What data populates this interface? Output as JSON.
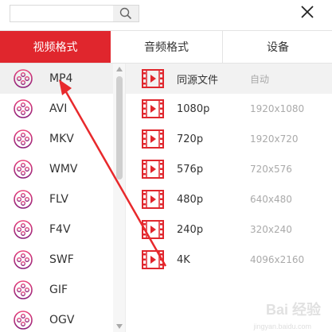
{
  "search": {
    "value": "",
    "placeholder": ""
  },
  "tabs": [
    {
      "label": "视频格式",
      "active": true
    },
    {
      "label": "音频格式",
      "active": false
    },
    {
      "label": "设备",
      "active": false
    }
  ],
  "formats": [
    {
      "label": "MP4",
      "selected": true
    },
    {
      "label": "AVI",
      "selected": false
    },
    {
      "label": "MKV",
      "selected": false
    },
    {
      "label": "WMV",
      "selected": false
    },
    {
      "label": "FLV",
      "selected": false
    },
    {
      "label": "F4V",
      "selected": false
    },
    {
      "label": "SWF",
      "selected": false
    },
    {
      "label": "GIF",
      "selected": false
    },
    {
      "label": "OGV",
      "selected": false
    }
  ],
  "qualities": [
    {
      "name": "同源文件",
      "resolution": "自动",
      "selected": true
    },
    {
      "name": "1080p",
      "resolution": "1920x1080",
      "selected": false
    },
    {
      "name": "720p",
      "resolution": "1920x720",
      "selected": false
    },
    {
      "name": "576p",
      "resolution": "720x576",
      "selected": false
    },
    {
      "name": "480p",
      "resolution": "640x480",
      "selected": false
    },
    {
      "name": "240p",
      "resolution": "320x240",
      "selected": false
    },
    {
      "name": "4K",
      "resolution": "4096x2160",
      "selected": false
    }
  ],
  "watermark": {
    "text": "Bai 经验",
    "sub": "jingyan.baidu.com"
  },
  "colors": {
    "accent": "#e0262d",
    "format_icon_top": "#e8417a",
    "format_icon_bottom": "#8b1f7a",
    "video_icon": "#e0262d"
  },
  "icons": {
    "search": "search-icon",
    "close": "close-icon",
    "format": "film-reel-icon",
    "quality": "film-strip-play-icon"
  }
}
